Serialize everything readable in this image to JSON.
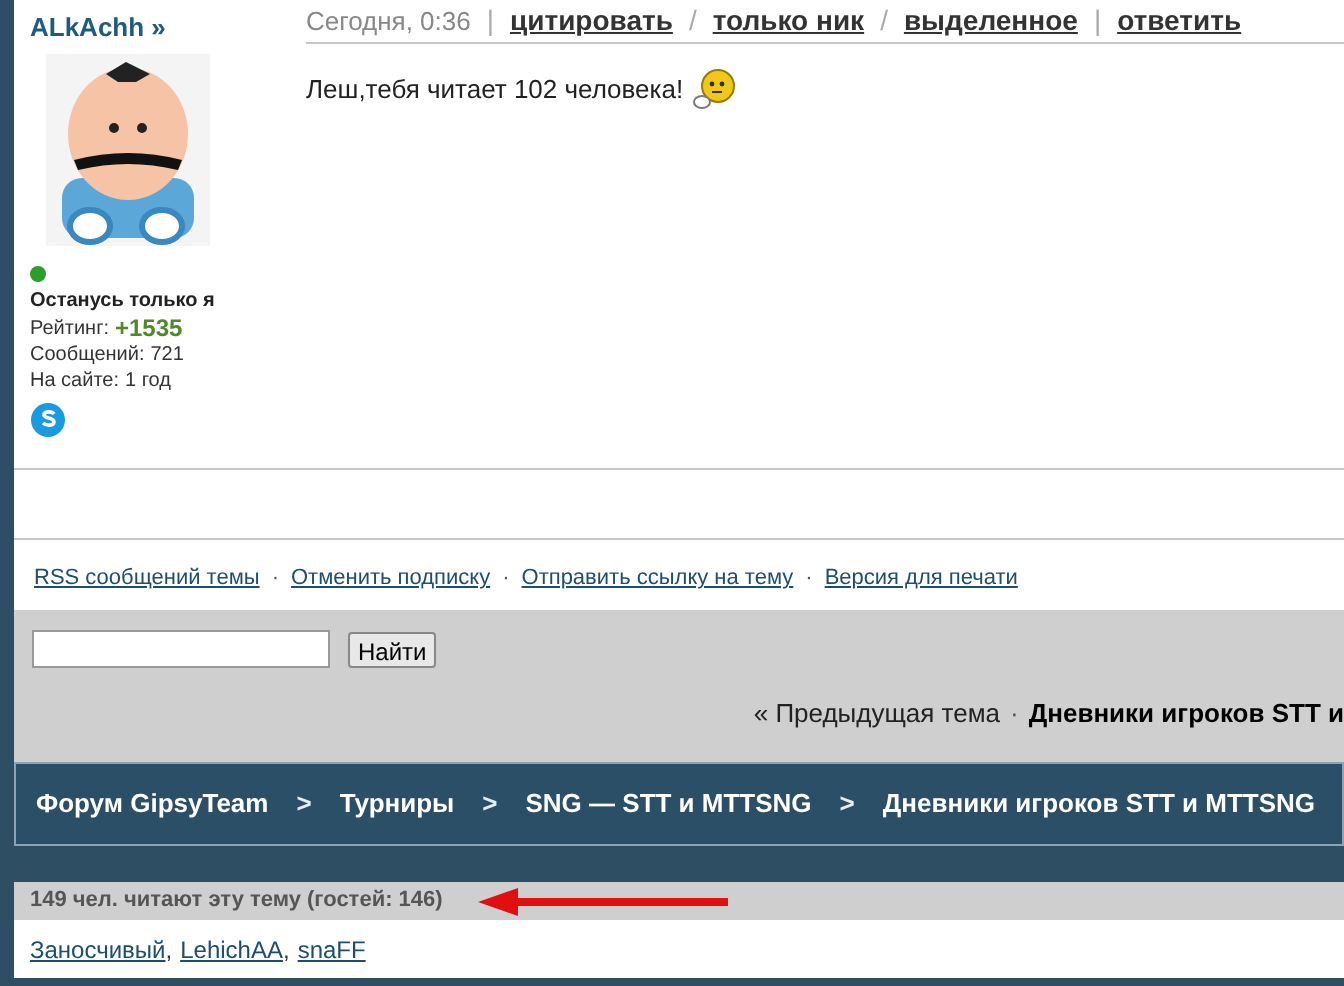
{
  "post": {
    "author": "ALkAchh »",
    "online": true,
    "user_title": "Останусь только я",
    "stats": [
      {
        "label": "Рейтинг:",
        "value": "+1535",
        "kind": "rating"
      },
      {
        "label": "Сообщений:",
        "value": "721",
        "kind": "plain"
      },
      {
        "label": "На сайте:",
        "value": "1 год",
        "kind": "plain"
      }
    ],
    "header": [
      {
        "kind": "date",
        "text": "Сегодня, 0:36"
      },
      {
        "kind": "sep",
        "text": "|"
      },
      {
        "kind": "link",
        "text": "цитировать"
      },
      {
        "kind": "sep",
        "text": "/"
      },
      {
        "kind": "link",
        "text": "только ник"
      },
      {
        "kind": "sep",
        "text": "/"
      },
      {
        "kind": "link",
        "text": "выделенное"
      },
      {
        "kind": "sep",
        "text": "|"
      },
      {
        "kind": "link",
        "text": "ответить"
      }
    ],
    "message": "Леш,тебя читает 102 человека!"
  },
  "topic_links": [
    {
      "kind": "link",
      "text": "RSS сообщений темы"
    },
    {
      "kind": "sep",
      "text": "·"
    },
    {
      "kind": "link",
      "text": "Отменить подписку"
    },
    {
      "kind": "sep",
      "text": "·"
    },
    {
      "kind": "link",
      "text": "Отправить ссылку на тему"
    },
    {
      "kind": "sep",
      "text": "·"
    },
    {
      "kind": "link",
      "text": "Версия для печати"
    }
  ],
  "search": {
    "button": "Найти"
  },
  "topic_nav": [
    {
      "kind": "link",
      "text": "« Предыдущая тема"
    },
    {
      "kind": "sep",
      "text": "·"
    },
    {
      "kind": "current",
      "text": "Дневники игроков STT и"
    }
  ],
  "breadcrumbs": [
    {
      "kind": "link",
      "text": "Форум GipsyTeam"
    },
    {
      "kind": "sep",
      "text": ">"
    },
    {
      "kind": "link",
      "text": "Турниры"
    },
    {
      "kind": "sep",
      "text": ">"
    },
    {
      "kind": "link",
      "text": "SNG — STT и MTTSNG"
    },
    {
      "kind": "sep",
      "text": ">"
    },
    {
      "kind": "link",
      "text": "Дневники игроков STT и MTTSNG"
    }
  ],
  "readers": {
    "title": "149 чел. читают эту тему (гостей: 146)",
    "users": [
      {
        "kind": "link",
        "text": "Заносчивый"
      },
      {
        "kind": "sep",
        "text": ","
      },
      {
        "kind": "link",
        "text": "LehichAA"
      },
      {
        "kind": "sep",
        "text": ","
      },
      {
        "kind": "link",
        "text": "snaFF"
      }
    ]
  }
}
